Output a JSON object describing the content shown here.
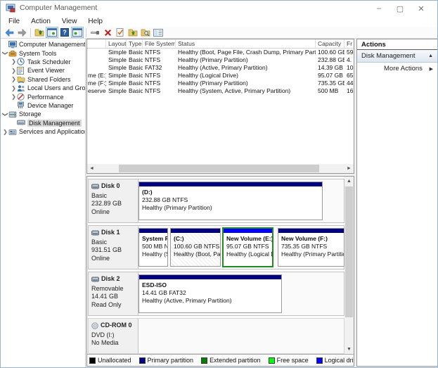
{
  "window": {
    "title": "Computer Management",
    "controls": {
      "minimize": "–",
      "maximize": "▢",
      "close": "✕"
    }
  },
  "menu": {
    "items": [
      "File",
      "Action",
      "View",
      "Help"
    ]
  },
  "toolbar": {
    "icons": [
      "back",
      "forward",
      "up-folder",
      "show-console-tree",
      "help",
      "show-action-pane",
      "remote-connection",
      "delete",
      "check-status",
      "open-folder",
      "find-folder",
      "properties-pane"
    ]
  },
  "tree": {
    "items": [
      {
        "label": "Computer Management (Local)"
      },
      {
        "label": "System Tools"
      },
      {
        "label": "Task Scheduler"
      },
      {
        "label": "Event Viewer"
      },
      {
        "label": "Shared Folders"
      },
      {
        "label": "Local Users and Groups"
      },
      {
        "label": "Performance"
      },
      {
        "label": "Device Manager"
      },
      {
        "label": "Storage"
      },
      {
        "label": "Disk Management"
      },
      {
        "label": "Services and Applications"
      }
    ]
  },
  "volume_list": {
    "columns": [
      "",
      "Layout",
      "Type",
      "File System",
      "Status",
      "Capacity",
      "Fr"
    ],
    "rows": [
      {
        "volume": "",
        "layout": "Simple",
        "type": "Basic",
        "fs": "NTFS",
        "status": "Healthy (Boot, Page File, Crash Dump, Primary Partition)",
        "capacity": "100.60 GB",
        "free": "59"
      },
      {
        "volume": "",
        "layout": "Simple",
        "type": "Basic",
        "fs": "NTFS",
        "status": "Healthy (Primary Partition)",
        "capacity": "232.88 GB",
        "free": "4."
      },
      {
        "volume": "",
        "layout": "Simple",
        "type": "Basic",
        "fs": "FAT32",
        "status": "Healthy (Active, Primary Partition)",
        "capacity": "14.39 GB",
        "free": "10"
      },
      {
        "volume": "me (E:)",
        "layout": "Simple",
        "type": "Basic",
        "fs": "NTFS",
        "status": "Healthy (Logical Drive)",
        "capacity": "95.07 GB",
        "free": "65"
      },
      {
        "volume": "me (F:)",
        "layout": "Simple",
        "type": "Basic",
        "fs": "NTFS",
        "status": "Healthy (Primary Partition)",
        "capacity": "735.35 GB",
        "free": "44"
      },
      {
        "volume": "eserved",
        "layout": "Simple",
        "type": "Basic",
        "fs": "NTFS",
        "status": "Healthy (System, Active, Primary Partition)",
        "capacity": "500 MB",
        "free": "16"
      }
    ]
  },
  "actions": {
    "header": "Actions",
    "group": "Disk Management",
    "collapse_icon": "▲",
    "more": "More Actions",
    "more_icon": "▶"
  },
  "disks": [
    {
      "name": "Disk 0",
      "lines": [
        "Basic",
        "232.89 GB",
        "Online"
      ],
      "partitions": [
        {
          "label": "(D:)",
          "size": "232.88 GB NTFS",
          "status": "Healthy (Primary Partition)",
          "bar_color": "#000080"
        }
      ]
    },
    {
      "name": "Disk 1",
      "lines": [
        "Basic",
        "931.51 GB",
        "Online"
      ],
      "partitions": [
        {
          "label": "System R",
          "size": "500 MB N",
          "status": "Healthy (S",
          "bar_color": "#000080"
        },
        {
          "label": "(C:)",
          "size": "100.60 GB NTFS",
          "status": "Healthy (Boot, Page File",
          "bar_color": "#000080"
        },
        {
          "label": "New Volume  (E:)",
          "size": "95.07 GB NTFS",
          "status": "Healthy (Logical Drive)",
          "bar_color": "#0000fa"
        },
        {
          "label": "New Volume  (F:)",
          "size": "735.35 GB NTFS",
          "status": "Healthy (Primary Partition)",
          "bar_color": "#000080"
        }
      ]
    },
    {
      "name": "Disk 2",
      "lines": [
        "Removable",
        "14.41 GB",
        "Read Only"
      ],
      "partitions": [
        {
          "label": "ESD-ISO",
          "size": "14.41 GB FAT32",
          "status": "Healthy (Active, Primary Partition)",
          "bar_color": "#000080"
        }
      ]
    },
    {
      "name": "CD-ROM 0",
      "lines": [
        "DVD (I:)",
        "",
        "No Media"
      ],
      "partitions": []
    }
  ],
  "legend": {
    "items": [
      {
        "label": "Unallocated",
        "color": "#000000"
      },
      {
        "label": "Primary partition",
        "color": "#000080"
      },
      {
        "label": "Extended partition",
        "color": "#008000"
      },
      {
        "label": "Free space",
        "color": "#00ff00"
      },
      {
        "label": "Logical drive",
        "color": "#0000ff"
      }
    ]
  }
}
